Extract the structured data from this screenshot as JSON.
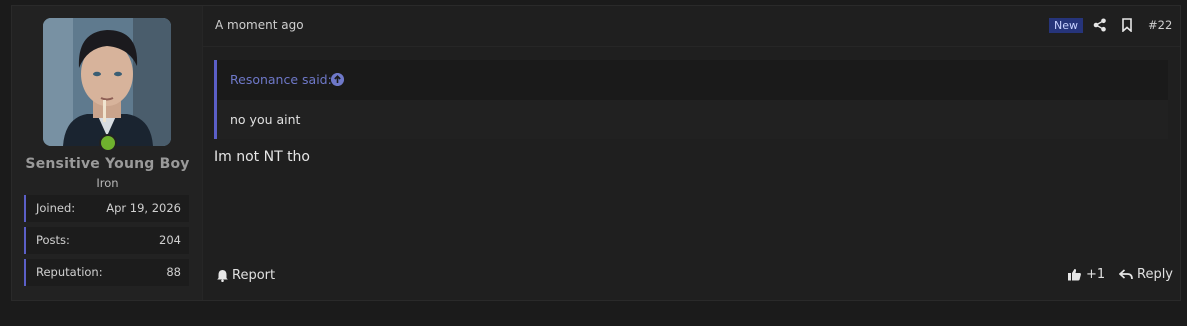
{
  "user": {
    "username": "Sensitive Young Boy",
    "title": "Iron",
    "online": true,
    "stats": [
      {
        "label": "Joined:",
        "value": "Apr 19, 2026"
      },
      {
        "label": "Posts:",
        "value": "204"
      },
      {
        "label": "Reputation:",
        "value": "88"
      }
    ]
  },
  "post": {
    "timestamp": "A moment ago",
    "new_badge": "New",
    "number": "#22",
    "quote": {
      "author": "Resonance said:",
      "text": "no you aint"
    },
    "message": "Im not NT tho"
  },
  "actions": {
    "report_label": "Report",
    "like_label": "+1",
    "reply_label": "Reply"
  },
  "icons": {
    "online": "online-dot-icon",
    "share": "share-icon",
    "bookmark": "bookmark-icon",
    "quote_jump": "arrow-up-circle-icon",
    "report": "bell-icon",
    "like": "thumbs-up-icon",
    "reply": "reply-arrow-icon"
  },
  "colors": {
    "accent": "#5b5fc7",
    "quote_author": "#6e78c8",
    "new_badge_bg": "#26347a",
    "online": "#6fb22e"
  }
}
